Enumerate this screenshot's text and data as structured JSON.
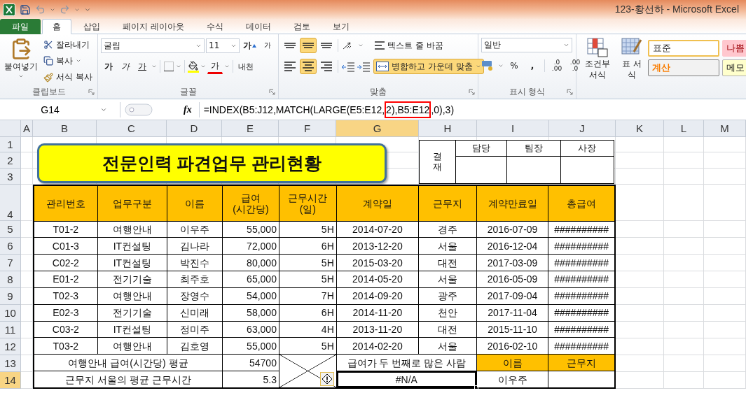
{
  "title_bar": {
    "title": "123-황선하  -  Microsoft Excel"
  },
  "tabs": [
    {
      "label": "파일",
      "kind": "file",
      "selected": false
    },
    {
      "label": "홈",
      "kind": "tab",
      "selected": true
    },
    {
      "label": "삽입",
      "kind": "tab",
      "selected": false
    },
    {
      "label": "페이지 레이아웃",
      "kind": "tab",
      "selected": false
    },
    {
      "label": "수식",
      "kind": "tab",
      "selected": false
    },
    {
      "label": "데이터",
      "kind": "tab",
      "selected": false
    },
    {
      "label": "검토",
      "kind": "tab",
      "selected": false
    },
    {
      "label": "보기",
      "kind": "tab",
      "selected": false
    }
  ],
  "ribbon": {
    "clipboard": {
      "paste": "붙여넣기",
      "cut": "잘라내기",
      "copy": "복사",
      "format_painter": "서식 복사",
      "label": "클립보드"
    },
    "font": {
      "name": "굴림",
      "size": "11",
      "grow": "가",
      "shrink": "가",
      "bold": "가",
      "italic": "가",
      "underline": "가",
      "font_color": "가",
      "phonetic": "내천",
      "label": "글꼴"
    },
    "alignment": {
      "vertical": [
        {
          "selected": false
        },
        {
          "selected": true
        },
        {
          "selected": false
        }
      ],
      "horizontal": [
        {
          "selected": false
        },
        {
          "selected": true
        },
        {
          "selected": false
        }
      ],
      "wrap": "텍스트 줄 바꿈",
      "merge": {
        "label": "병합하고 가운데 맞춤",
        "selected": true
      },
      "label": "맞춤"
    },
    "number": {
      "format": "일반",
      "percent": "%",
      "comma": ",",
      "decimal_increase": [
        ".0",
        ".00"
      ],
      "decimal_decrease": [
        ".00",
        ".0"
      ],
      "label": "표시 형식"
    },
    "styles": {
      "conditional": "조건부 서식",
      "table": "표 서식",
      "cells": [
        {
          "label": "표준",
          "kind": "normal"
        },
        {
          "label": "나쁨",
          "kind": "bad"
        },
        {
          "label": "계산",
          "kind": "calc"
        },
        {
          "label": "메모",
          "kind": "note"
        }
      ]
    }
  },
  "formula_bar": {
    "name_box": "G14",
    "fx": "fx",
    "formula": {
      "before": "=INDEX(B5:J12,MATCH(LARGE(E5:E12,",
      "highlighted": "2),B5:E12",
      "after": ",0),3)"
    }
  },
  "sheet": {
    "columns": [
      {
        "label": "A",
        "selected": false
      },
      {
        "label": "B",
        "selected": false
      },
      {
        "label": "C",
        "selected": false
      },
      {
        "label": "D",
        "selected": false
      },
      {
        "label": "E",
        "selected": false
      },
      {
        "label": "F",
        "selected": false
      },
      {
        "label": "G",
        "selected": true
      },
      {
        "label": "H",
        "selected": false
      },
      {
        "label": "I",
        "selected": false
      },
      {
        "label": "J",
        "selected": false
      },
      {
        "label": "K",
        "selected": false
      },
      {
        "label": "L",
        "selected": false
      },
      {
        "label": "M",
        "selected": false
      }
    ],
    "rows": [
      {
        "label": "1",
        "selected": false
      },
      {
        "label": "2",
        "selected": false
      },
      {
        "label": "3",
        "selected": false
      },
      {
        "label": "4",
        "selected": false
      },
      {
        "label": "5",
        "selected": false
      },
      {
        "label": "6",
        "selected": false
      },
      {
        "label": "7",
        "selected": false
      },
      {
        "label": "8",
        "selected": false
      },
      {
        "label": "9",
        "selected": false
      },
      {
        "label": "10",
        "selected": false
      },
      {
        "label": "11",
        "selected": false
      },
      {
        "label": "12",
        "selected": false
      },
      {
        "label": "13",
        "selected": false
      },
      {
        "label": "14",
        "selected": true
      }
    ],
    "title_shape": "전문인력 파견업무 관리현황",
    "approval": {
      "label": "결재",
      "roles": [
        "담당",
        "팀장",
        "사장"
      ]
    },
    "table": {
      "headers": [
        "관리번호",
        "업무구분",
        "이름",
        "급여\n(시간당)",
        "근무시간\n(일)",
        "계약일",
        "근무지",
        "계약만료일",
        "총급여"
      ],
      "rows": [
        [
          "T01-2",
          "여행안내",
          "이우주",
          "55,000",
          "5H",
          "2014-07-20",
          "경주",
          "2016-07-09",
          "##########"
        ],
        [
          "C01-3",
          "IT컨설팅",
          "김나라",
          "72,000",
          "6H",
          "2013-12-20",
          "서울",
          "2016-12-04",
          "##########"
        ],
        [
          "C02-2",
          "IT컨설팅",
          "박진수",
          "80,000",
          "5H",
          "2015-03-20",
          "대전",
          "2017-03-09",
          "##########"
        ],
        [
          "E01-2",
          "전기기술",
          "최주호",
          "65,000",
          "5H",
          "2014-05-20",
          "서울",
          "2016-05-09",
          "##########"
        ],
        [
          "T02-3",
          "여행안내",
          "장영수",
          "54,000",
          "7H",
          "2014-09-20",
          "광주",
          "2017-09-04",
          "##########"
        ],
        [
          "E02-3",
          "전기기술",
          "신미래",
          "58,000",
          "6H",
          "2014-11-20",
          "천안",
          "2017-11-04",
          "##########"
        ],
        [
          "C03-2",
          "IT컨설팅",
          "정미주",
          "63,000",
          "4H",
          "2013-11-20",
          "대전",
          "2015-11-10",
          "##########"
        ],
        [
          "T03-2",
          "여행안내",
          "김호영",
          "55,000",
          "5H",
          "2014-02-20",
          "서울",
          "2016-02-10",
          "##########"
        ]
      ],
      "summary": {
        "avg_label": "여행안내 급여(시간당) 평균",
        "avg_value": "54700",
        "hours_label": "근무지 서울의 평균 근무시간",
        "hours_value": "5.3",
        "question": "급여가 두 번째로 많은 사람",
        "result": {
          "text": "#N/A",
          "selected": true
        },
        "name_header": "이름",
        "location_header": "근무지",
        "name_value": "이우주"
      }
    }
  }
}
